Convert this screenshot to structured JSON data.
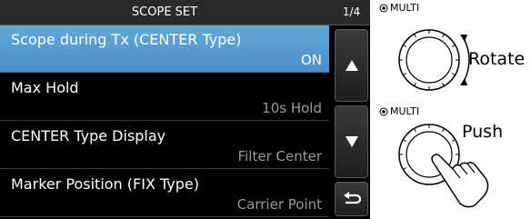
{
  "screen": {
    "title": "SCOPE SET",
    "page": "1/4",
    "items": [
      {
        "label": "Scope during Tx (CENTER Type)",
        "value": "ON",
        "selected": true
      },
      {
        "label": "Max Hold",
        "value": "10s Hold",
        "selected": false
      },
      {
        "label": "CENTER Type Display",
        "value": "Filter Center",
        "selected": false
      },
      {
        "label": "Marker Position (FIX Type)",
        "value": "Carrier Point",
        "selected": false
      }
    ],
    "buttons": {
      "up": "up-arrow-icon",
      "down": "down-arrow-icon",
      "back": "return-icon"
    }
  },
  "controls": {
    "rotate_dial_label": "MULTI",
    "rotate_action": "Rotate",
    "push_dial_label": "MULTI",
    "push_action": "Push"
  }
}
